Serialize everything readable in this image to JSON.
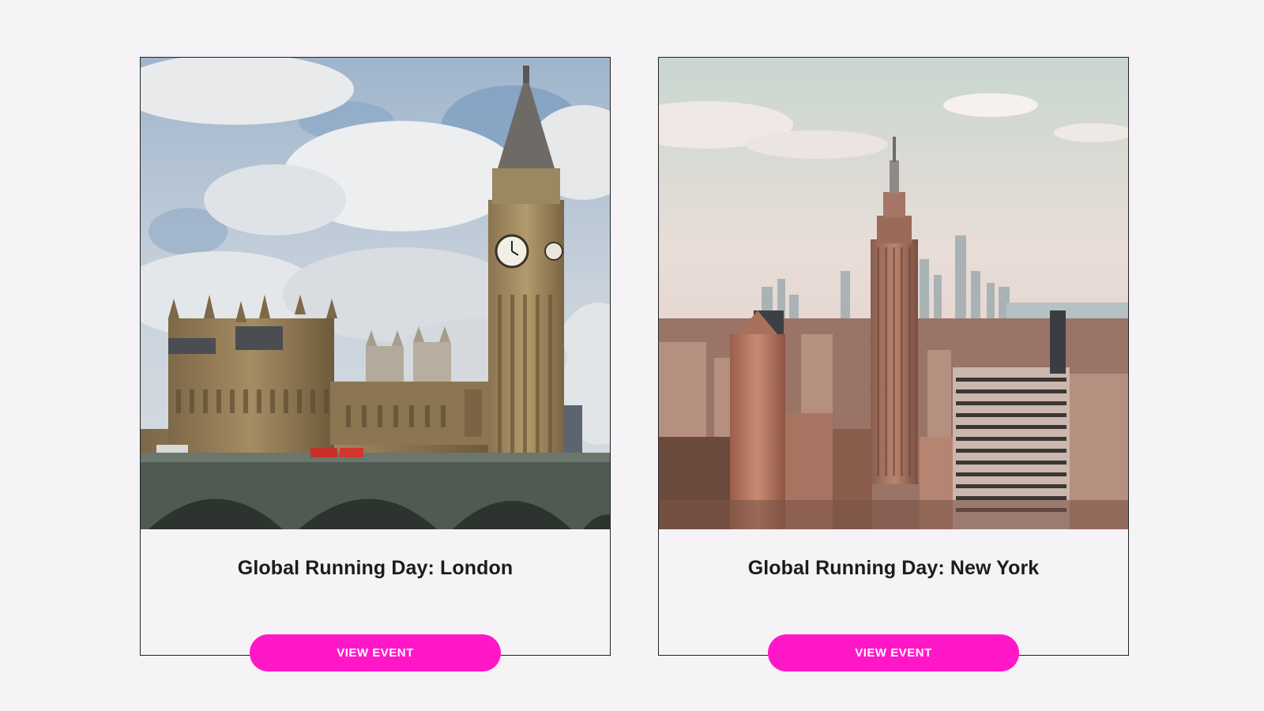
{
  "events": [
    {
      "title": "Global Running Day: London",
      "button_label": "VIEW EVENT",
      "image": "photo of Big Ben, Houses of Parliament and Westminster Bridge"
    },
    {
      "title": "Global Running Day: New York",
      "button_label": "VIEW EVENT",
      "image": "aerial photo of Manhattan skyline with Empire State Building"
    }
  ],
  "colors": {
    "page_background": "#f5f3f6",
    "card_border": "#222222",
    "button_background": "#ff17c8",
    "button_text": "#ffffff",
    "title_text": "#1c1c1c"
  }
}
